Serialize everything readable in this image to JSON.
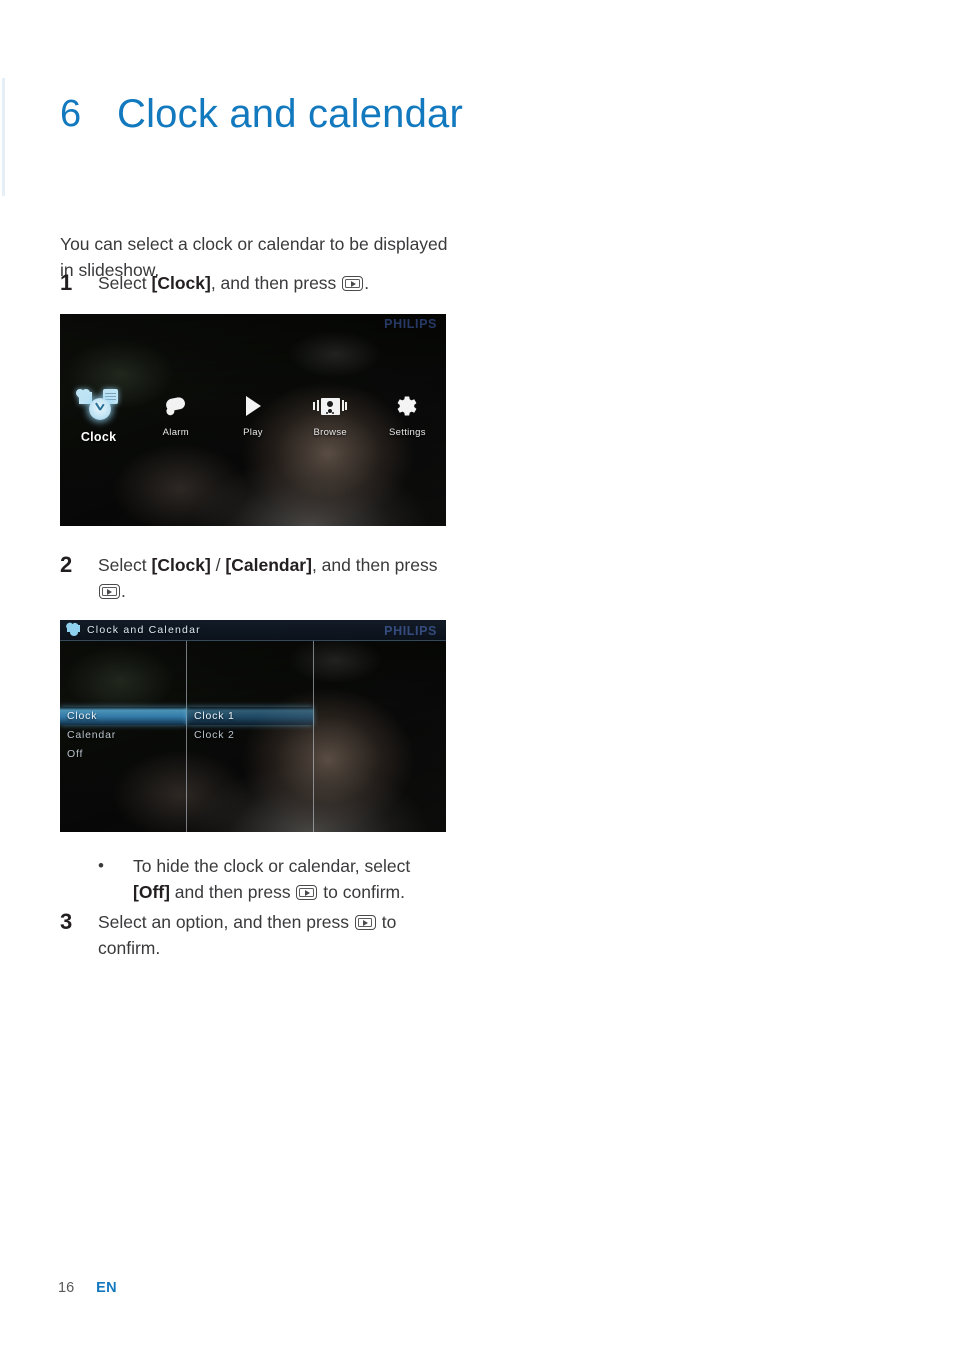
{
  "page": {
    "chapter_number": "6",
    "chapter_title": "Clock and calendar",
    "footer_page_number": "16",
    "footer_language": "EN",
    "accent_color": "#1279bf",
    "text_color": "#3a3a3c"
  },
  "body": {
    "intro": "You can select a clock or calendar to be displayed in slideshow.",
    "steps": [
      {
        "number": "1",
        "parts": [
          {
            "text": "Select ",
            "bold": false
          },
          {
            "text": "[Clock]",
            "bold": true
          },
          {
            "text": ", and then press ",
            "bold": false
          },
          {
            "icon": "play-key-icon"
          },
          {
            "text": ".",
            "bold": false
          }
        ]
      },
      {
        "number": "2",
        "parts": [
          {
            "text": "Select ",
            "bold": false
          },
          {
            "text": "[Clock]",
            "bold": true
          },
          {
            "text": " / ",
            "bold": false
          },
          {
            "text": "[Calendar]",
            "bold": true
          },
          {
            "text": ", and then press ",
            "bold": false
          },
          {
            "icon": "play-key-icon"
          },
          {
            "text": ".",
            "bold": false
          }
        ]
      },
      {
        "number": "3",
        "parts": [
          {
            "text": "Select an option, and then press ",
            "bold": false
          },
          {
            "icon": "play-key-icon"
          },
          {
            "text": " to confirm.",
            "bold": false
          }
        ]
      }
    ],
    "note": {
      "bullet": "•",
      "parts": [
        {
          "text": "To hide the clock or calendar, select ",
          "bold": false
        },
        {
          "text": "[Off]",
          "bold": true
        },
        {
          "text": " and then press ",
          "bold": false
        },
        {
          "icon": "play-key-icon"
        },
        {
          "text": " to confirm.",
          "bold": false
        }
      ]
    }
  },
  "figure_home": {
    "brand": "PHILIPS",
    "menu_items": [
      {
        "label": "Clock",
        "icon": "clock-calendar-icon",
        "selected": true
      },
      {
        "label": "Alarm",
        "icon": "alarm-bell-icon",
        "selected": false
      },
      {
        "label": "Play",
        "icon": "play-triangle-icon",
        "selected": false
      },
      {
        "label": "Browse",
        "icon": "browse-photo-icon",
        "selected": false
      },
      {
        "label": "Settings",
        "icon": "gear-icon",
        "selected": false
      }
    ]
  },
  "figure_menu": {
    "brand": "PHILIPS",
    "titlebar_icon": "clock-heart-icon",
    "titlebar_title": "Clock and Calendar",
    "column_1": [
      {
        "label": "Clock",
        "selected": true
      },
      {
        "label": "Calendar",
        "selected": false
      },
      {
        "label": "Off",
        "selected": false
      }
    ],
    "column_2": [
      {
        "label": "Clock 1",
        "selected": true
      },
      {
        "label": "Clock 2",
        "selected": false
      }
    ]
  }
}
